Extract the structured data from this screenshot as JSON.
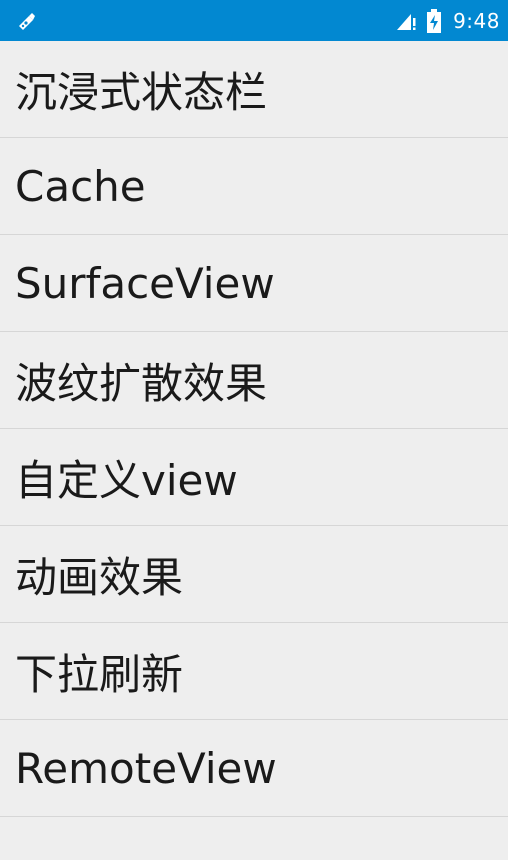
{
  "status_bar": {
    "left_icon": "usb-debug-icon",
    "signal_icon": "signal-no-data-icon",
    "battery_icon": "battery-charging-icon",
    "time": "9:48",
    "background": "#0288d1"
  },
  "list": {
    "items": [
      {
        "label": "沉浸式状态栏"
      },
      {
        "label": "Cache"
      },
      {
        "label": "SurfaceView"
      },
      {
        "label": "波纹扩散效果"
      },
      {
        "label": "自定义view"
      },
      {
        "label": "动画效果"
      },
      {
        "label": "下拉刷新"
      },
      {
        "label": "RemoteView"
      }
    ]
  }
}
